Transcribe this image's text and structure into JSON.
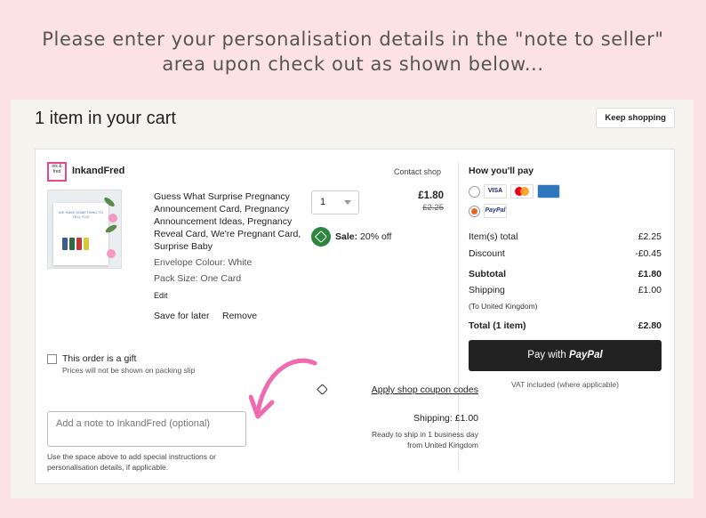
{
  "banner": {
    "line1": "Please enter your personalisation details in the \"note to seller\"",
    "line2": "area upon check out as shown below..."
  },
  "cart": {
    "title": "1 item in your cart",
    "keep_shopping": "Keep shopping"
  },
  "shop": {
    "logo_text": "ink & fred",
    "name": "InkandFred",
    "contact": "Contact shop"
  },
  "item": {
    "image_text": "WE HAVE SOMETHING TO TELL YOU",
    "title": "Guess What Surprise Pregnancy Announcement Card, Pregnancy Announcement Ideas, Pregnancy Reveal Card, We're Pregnant Card, Surprise Baby",
    "option_envelope": "Envelope Colour: White",
    "option_pack": "Pack Size: One Card",
    "edit": "Edit",
    "save_later": "Save for later",
    "remove": "Remove",
    "quantity": "1",
    "price": "£1.80",
    "original_price": "£2.25",
    "sale_label": "Sale:",
    "sale_value": "20% off"
  },
  "gift": {
    "label": "This order is a gift",
    "sub": "Prices will not be shown on packing slip"
  },
  "coupon": "Apply shop coupon codes",
  "note": {
    "placeholder": "Add a note to InkandFred (optional)",
    "help": "Use the space above to add special instructions or personalisation details, if applicable."
  },
  "shipping": {
    "cost": "Shipping: £1.00",
    "ready_line1": "Ready to ship in 1 business day",
    "ready_line2": "from United Kingdom"
  },
  "payment": {
    "title": "How you'll pay",
    "methods": [
      "VISA",
      "Mastercard",
      "Amex",
      "PayPal"
    ],
    "selected": "PayPal"
  },
  "summary": {
    "items_total_label": "Item(s) total",
    "items_total": "£2.25",
    "discount_label": "Discount",
    "discount": "-£0.45",
    "subtotal_label": "Subtotal",
    "subtotal": "£1.80",
    "shipping_label": "Shipping",
    "shipping": "£1.00",
    "shipping_to": "(To United Kingdom)",
    "total_label": "Total (1 item)",
    "total": "£2.80"
  },
  "pay_button": {
    "prefix": "Pay with",
    "brand": "PayPal"
  },
  "vat": "VAT included (where applicable)",
  "colors": {
    "background": "#fde2e4",
    "panel": "#f5f4ef",
    "sale_green": "#2e8540",
    "arrow_pink": "#f06ab0",
    "pay_button": "#222222",
    "logo_border": "#e8478b"
  }
}
